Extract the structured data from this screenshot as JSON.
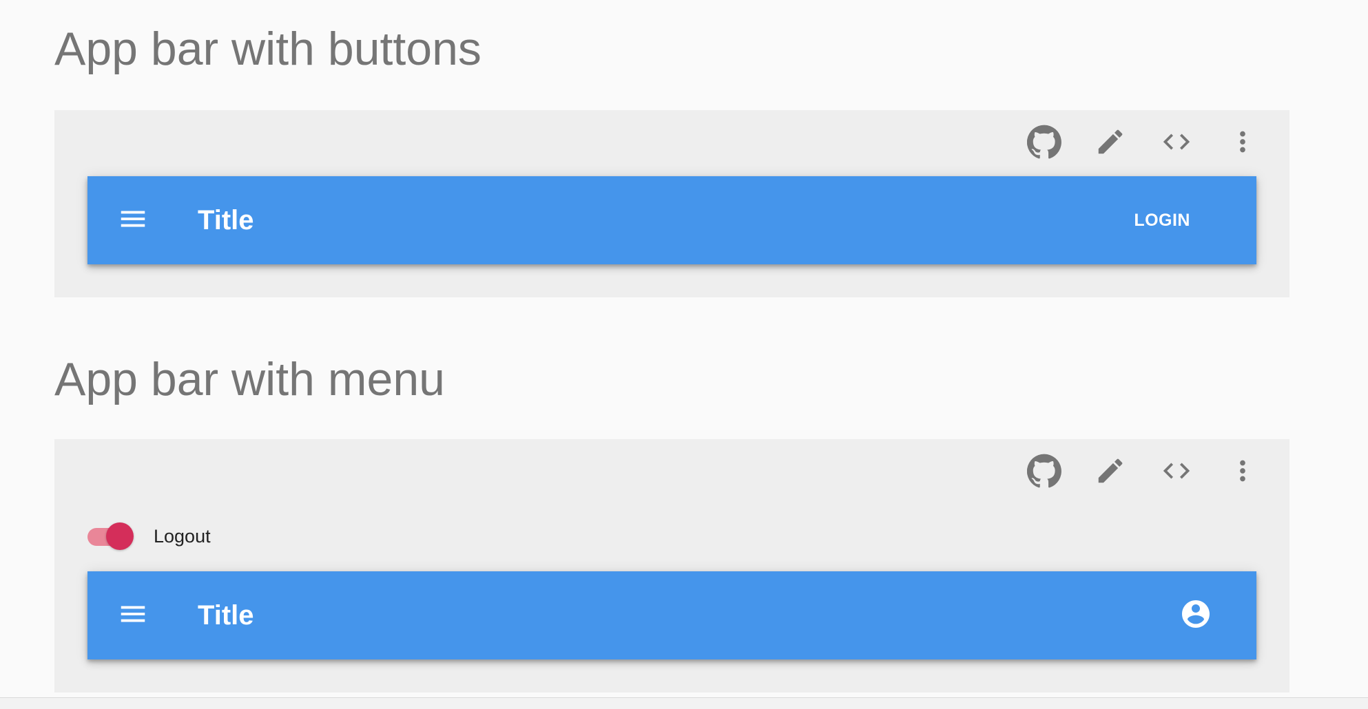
{
  "sections": [
    {
      "heading": "App bar with buttons",
      "toolbar": {
        "github_title": "GitHub",
        "edit_title": "Edit",
        "code_title": "Show source",
        "more_title": "More"
      },
      "appbar": {
        "title": "Title",
        "login_label": "LOGIN"
      }
    },
    {
      "heading": "App bar with menu",
      "toolbar": {
        "github_title": "GitHub",
        "edit_title": "Edit",
        "code_title": "Show source",
        "more_title": "More"
      },
      "switch": {
        "label": "Logout",
        "checked": true
      },
      "appbar": {
        "title": "Title"
      }
    }
  ],
  "colors": {
    "page_background": "#fafafa",
    "demo_background": "#eeeeee",
    "appbar": "#4595eb",
    "heading": "#757575",
    "icon": "#757575",
    "switch_thumb": "#d42e5a",
    "switch_track": "#e98698"
  },
  "icons": {
    "toolbar": [
      "github-icon",
      "pencil-icon",
      "code-icon",
      "more-vert-icon"
    ],
    "appbar_menu": "menu-icon",
    "appbar_account": "account-circle-icon"
  }
}
